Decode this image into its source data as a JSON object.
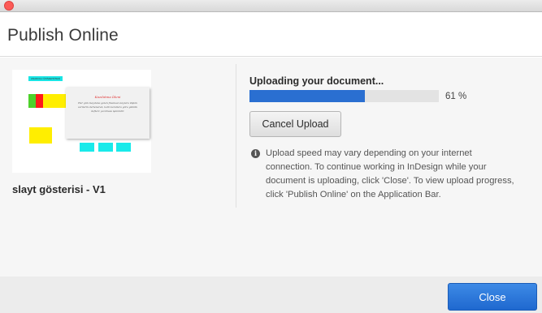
{
  "window": {
    "title_bar_controls": [
      "close"
    ]
  },
  "dialog": {
    "title": "Publish Online"
  },
  "document": {
    "name": "slayt gösterisi - V1",
    "thumbnail": {
      "label": "ANADOLU ÜNİVERSİTESİ",
      "card_title": "Kazılatma İdeni",
      "card_body": "Her gün meydana gelen finansal olaylara ilişkin verilerin derlenerek, belli kurallara göre günlük defterc yazılması işlemidir."
    }
  },
  "upload": {
    "status": "Uploading your document...",
    "progress_percent": 61,
    "progress_label": "61 %",
    "cancel_label": "Cancel Upload",
    "info_icon": "info-icon",
    "info_text": "Upload speed may vary depending on your internet connection. To continue working in InDesign while your document is uploading, click 'Close'. To view upload progress, click 'Publish Online' on the Application Bar."
  },
  "footer": {
    "close_label": "Close"
  },
  "colors": {
    "accent": "#2a6fd1",
    "close_button": "#2a72d8"
  }
}
